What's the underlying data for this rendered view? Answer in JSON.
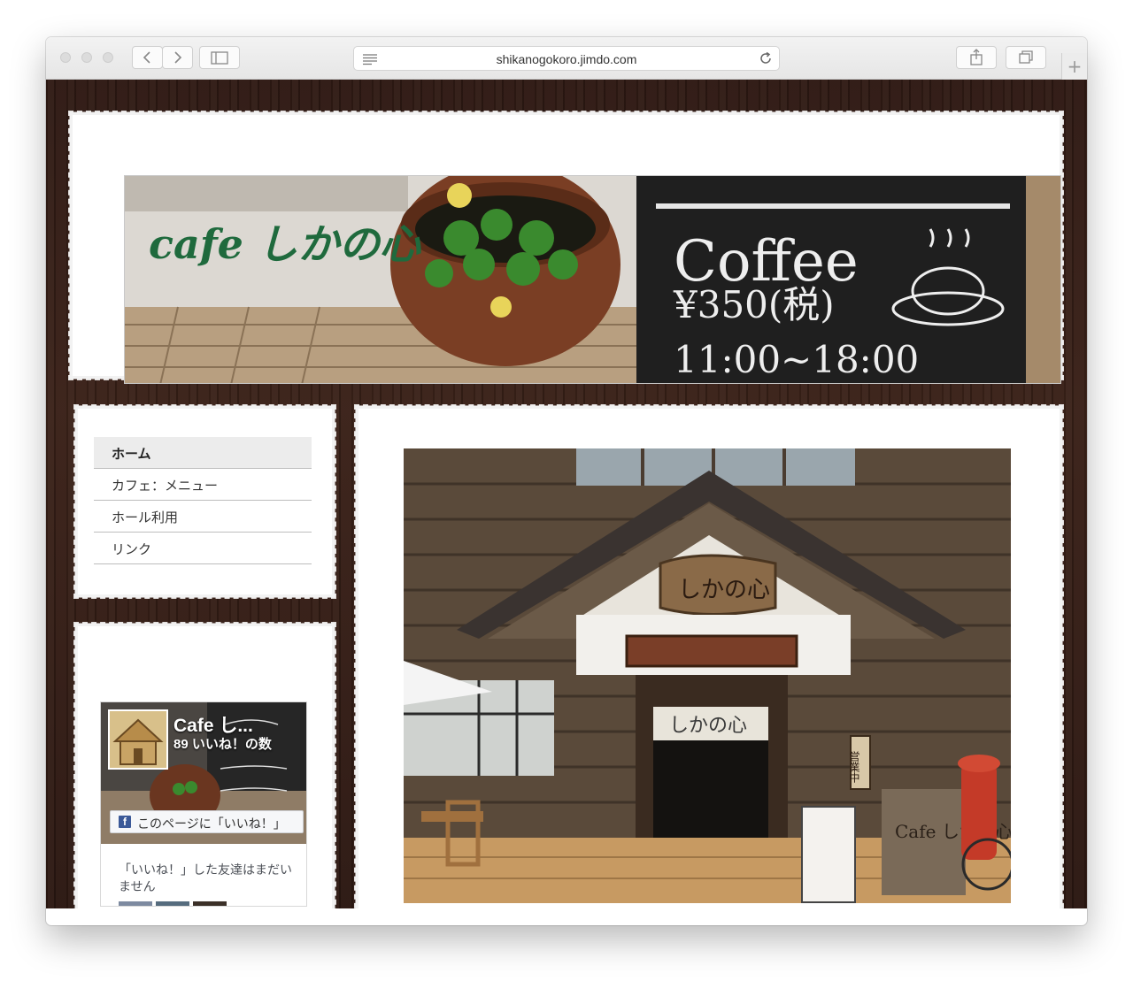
{
  "browser": {
    "url": "shikanogokoro.jimdo.com"
  },
  "site": {
    "title": "cafe しかの心"
  },
  "header_image": {
    "chalkboard_lines": [
      "Coffee",
      "¥350(税)",
      "11:00~18:00"
    ]
  },
  "nav": {
    "items": [
      {
        "label": "ホーム"
      },
      {
        "label": "カフェ：メニュー"
      },
      {
        "label": "ホール利用"
      },
      {
        "label": "リンク"
      }
    ]
  },
  "facebook": {
    "page_name": "Cafe し...",
    "likes": "89 いいね！の数",
    "like_button": "このページに「いいね！」",
    "friends_text": "「いいね！」した友達はまだいません"
  },
  "main_photo": {
    "sign": "しかの心",
    "noren": "しかの心",
    "board": "Cafe しかの心",
    "vertical_sign": "営業中"
  },
  "colors": {
    "title_green": "#1f6a3d",
    "wood_dark": "#2f1a14",
    "facebook_blue": "#3b5998"
  }
}
